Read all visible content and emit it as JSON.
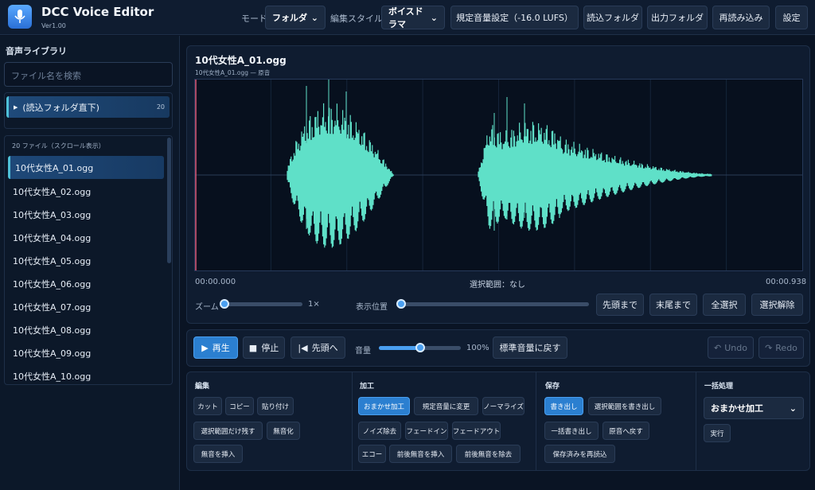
{
  "app": {
    "title": "DCC Voice Editor",
    "version": "Ver1.00"
  },
  "header": {
    "mode_label": "モード",
    "mode_value": "フォルダ",
    "style_label": "編集スタイル",
    "style_value": "ボイスドラマ",
    "loudness_button": "規定音量設定（-16.0 LUFS）",
    "input_folder_button": "読込フォルダ",
    "output_folder_button": "出力フォルダ",
    "reload_button": "再読み込み",
    "settings_button": "設定"
  },
  "sidebar": {
    "title": "音声ライブラリ",
    "search_placeholder": "ファイル名を検索",
    "folder": {
      "label": "(読込フォルダ直下)",
      "count": "20"
    },
    "files_header": "20 ファイル（スクロール表示）",
    "files": [
      "10代女性A_01.ogg",
      "10代女性A_02.ogg",
      "10代女性A_03.ogg",
      "10代女性A_04.ogg",
      "10代女性A_05.ogg",
      "10代女性A_06.ogg",
      "10代女性A_07.ogg",
      "10代女性A_08.ogg",
      "10代女性A_09.ogg",
      "10代女性A_10.ogg"
    ],
    "selected_index": 0
  },
  "waveform": {
    "title": "10代女性A_01.ogg",
    "subtitle": "10代女性A_01.ogg — 原音",
    "time_start": "00:00.000",
    "selection": "選択範囲：なし",
    "time_end": "00:00.938",
    "color": "#5fe0c8"
  },
  "view": {
    "zoom_label": "ズーム",
    "zoom_value": "1×",
    "position_label": "表示位置",
    "zoom_level": 0,
    "position_level": 0,
    "to_start": "先頭まで",
    "to_end": "末尾まで",
    "select_all": "全選択",
    "deselect": "選択解除"
  },
  "transport": {
    "play": "再生",
    "stop": "停止",
    "rewind": "先頭へ",
    "volume_label": "音量",
    "volume_value": "100%",
    "volume_level": 0.5,
    "reset_volume": "標準音量に戻す",
    "undo": "Undo",
    "redo": "Redo"
  },
  "tools": {
    "edit": {
      "title": "編集",
      "buttons": [
        "カット",
        "コピー",
        "貼り付け",
        "選択範囲だけ残す",
        "無音化",
        "無音を挿入"
      ]
    },
    "process": {
      "title": "加工",
      "buttons": [
        "おまかせ加工",
        "規定音量に変更",
        "ノーマライズ",
        "ノイズ除去",
        "フェードイン",
        "フェードアウト",
        "エコー",
        "前後無音を挿入",
        "前後無音を除去"
      ]
    },
    "save": {
      "title": "保存",
      "buttons": [
        "書き出し",
        "選択範囲を書き出し",
        "一括書き出し",
        "原音へ戻す",
        "保存済みを再読込"
      ]
    },
    "batch": {
      "title": "一括処理",
      "select_value": "おまかせ加工",
      "run": "実行"
    }
  }
}
